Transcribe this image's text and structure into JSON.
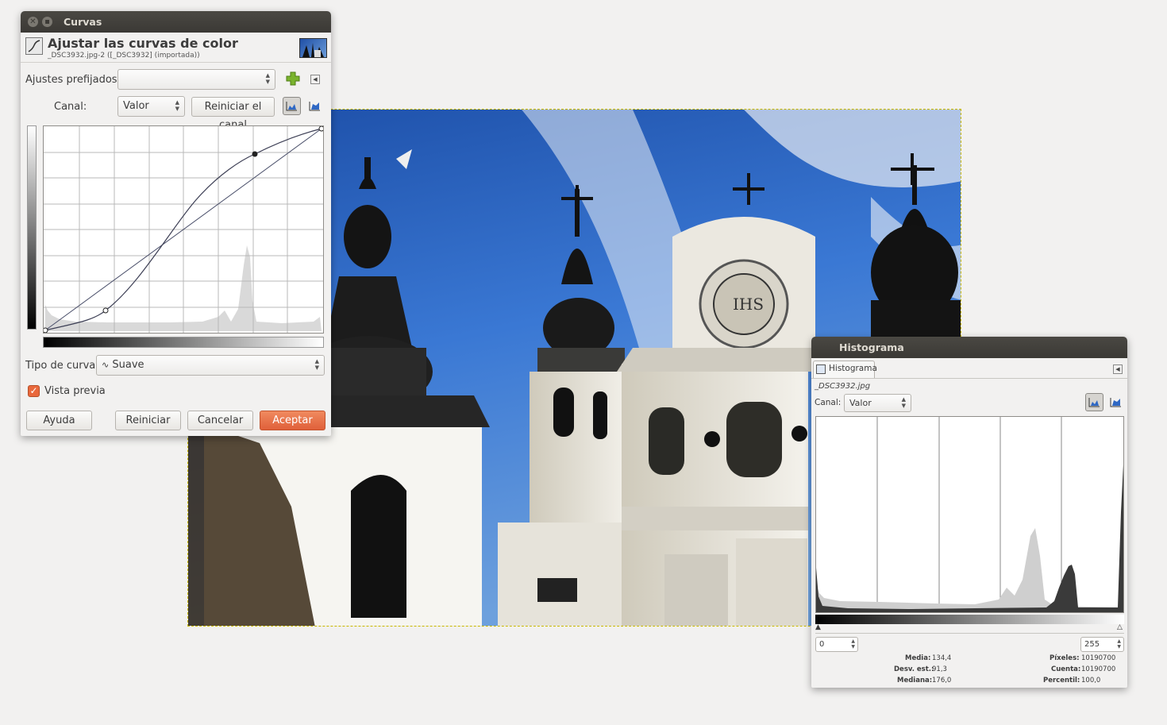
{
  "curves_window": {
    "title": "Curvas",
    "heading": "Ajustar las curvas de color",
    "subheading": "_DSC3932.jpg-2 ([_DSC3932] (importada))",
    "presets_label": "Ajustes prefijados:",
    "presets_value": "",
    "channel_label": "Canal:",
    "channel_value": "Valor",
    "reset_channel_label": "Reiniciar el canal",
    "curve_type_label": "Tipo de curva:",
    "curve_type_value": "Suave",
    "preview_label": "Vista previa",
    "preview_checked": true,
    "buttons": {
      "help": "Ayuda",
      "reset": "Reiniciar",
      "cancel": "Cancelar",
      "ok": "Aceptar"
    },
    "accent_color": "#e9683c"
  },
  "histogram_window": {
    "title": "Histograma",
    "tab_label": "Histograma",
    "image_name": "_DSC3932.jpg",
    "channel_label": "Canal:",
    "channel_value": "Valor",
    "range_min": "0",
    "range_max": "255",
    "stats": {
      "mean_label": "Media:",
      "mean": "134,4",
      "stddev_label": "Desv. est.:",
      "stddev": "91,3",
      "median_label": "Mediana:",
      "median": "176,0",
      "pixels_label": "Píxeles:",
      "pixels": "10190700",
      "count_label": "Cuenta:",
      "count": "10190700",
      "percentile_label": "Percentil:",
      "percentile": "100,0"
    }
  },
  "colors": {
    "titlebar": "#3c3b37",
    "sky": "#2f68c4",
    "facade": "#e9e6dd"
  }
}
